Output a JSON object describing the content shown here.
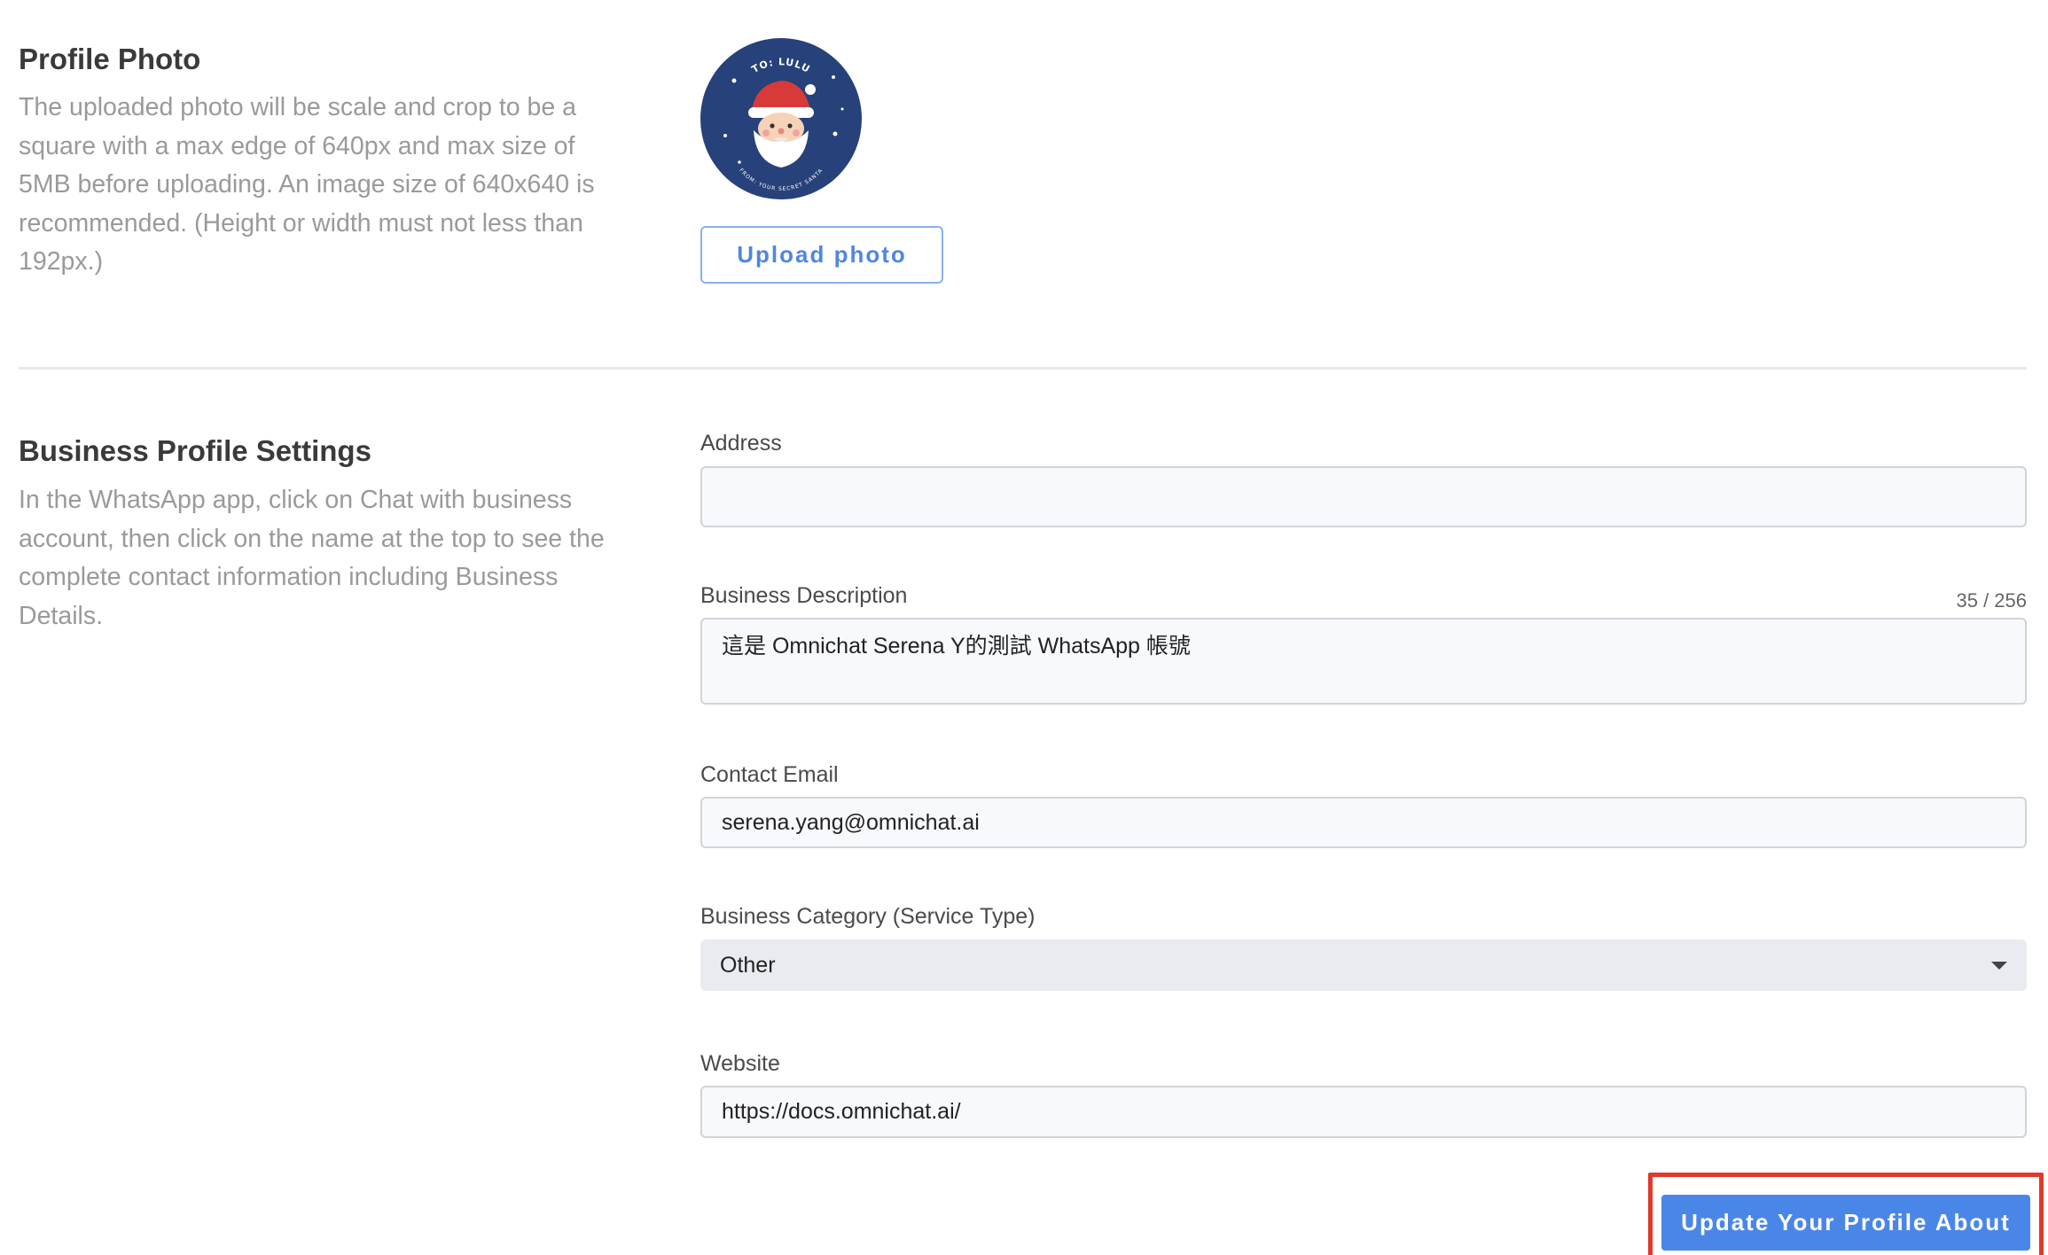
{
  "profile_photo": {
    "title": "Profile Photo",
    "description": "The uploaded photo will be scale and crop to be a square with a max edge of 640px and max size of 5MB before uploading. An image size of 640x640 is recommended. (Height or width must not less than 192px.)",
    "avatar_top_text": "TO: LULU",
    "avatar_bottom_text": "FROM: YOUR SECRET SANTA",
    "upload_label": "Upload photo"
  },
  "business_profile": {
    "title": "Business Profile Settings",
    "description": "In the WhatsApp app, click on Chat with business account, then click on the name at the top to see the complete contact information including Business Details."
  },
  "form": {
    "address": {
      "label": "Address",
      "value": ""
    },
    "description": {
      "label": "Business Description",
      "value": "這是 Omnichat Serena Y的測試 WhatsApp 帳號",
      "counter": "35 / 256"
    },
    "email": {
      "label": "Contact Email",
      "value": "serena.yang@omnichat.ai"
    },
    "category": {
      "label": "Business Category (Service Type)",
      "value": "Other"
    },
    "website": {
      "label": "Website",
      "value": "https://docs.omnichat.ai/"
    }
  },
  "submit": {
    "label": "Update Your Profile About"
  },
  "colors": {
    "primary": "#4a86e8",
    "highlight": "#e0392b",
    "avatar_bg": "#27417a"
  }
}
